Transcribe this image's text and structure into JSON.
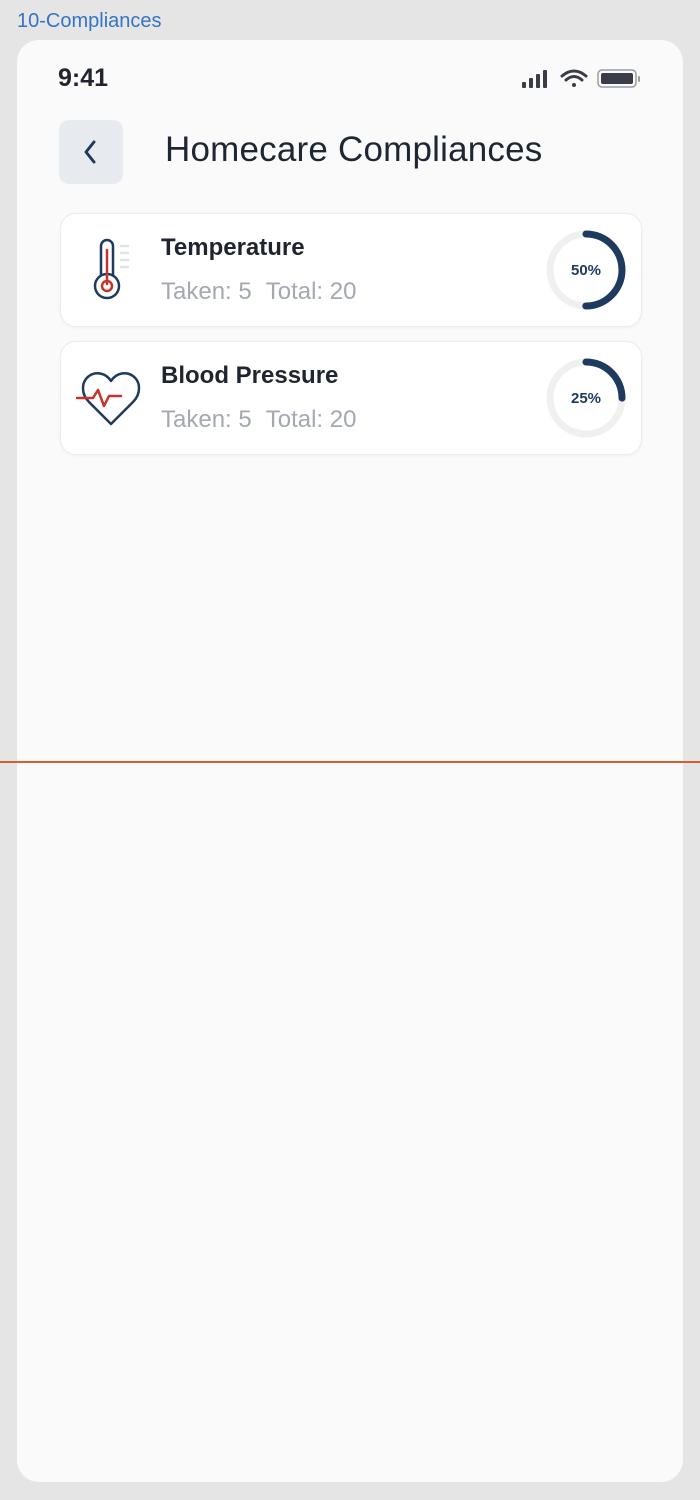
{
  "frame": {
    "label": "10-Compliances"
  },
  "status_bar": {
    "time": "9:41",
    "icons": [
      "signal-icon",
      "wifi-icon",
      "battery-icon"
    ]
  },
  "header": {
    "back_icon": "chevron-left-icon",
    "title": "Homecare Compliances"
  },
  "compliances": [
    {
      "name": "Temperature",
      "icon": "thermometer-icon",
      "taken_text": "Taken: 5",
      "total_text": "Total: 20",
      "percent_label": "50%",
      "progress": 0.5
    },
    {
      "name": "Blood Pressure",
      "icon": "heart-pulse-icon",
      "taken_text": "Taken: 5",
      "total_text": "Total: 20",
      "percent_label": "25%",
      "progress": 0.25
    }
  ],
  "colors": {
    "accent": "#1e3a5f",
    "alert_red": "#c8322d",
    "ring_track": "#f0f0f0",
    "frame_label": "#3574c4",
    "divider": "#d75b33"
  }
}
